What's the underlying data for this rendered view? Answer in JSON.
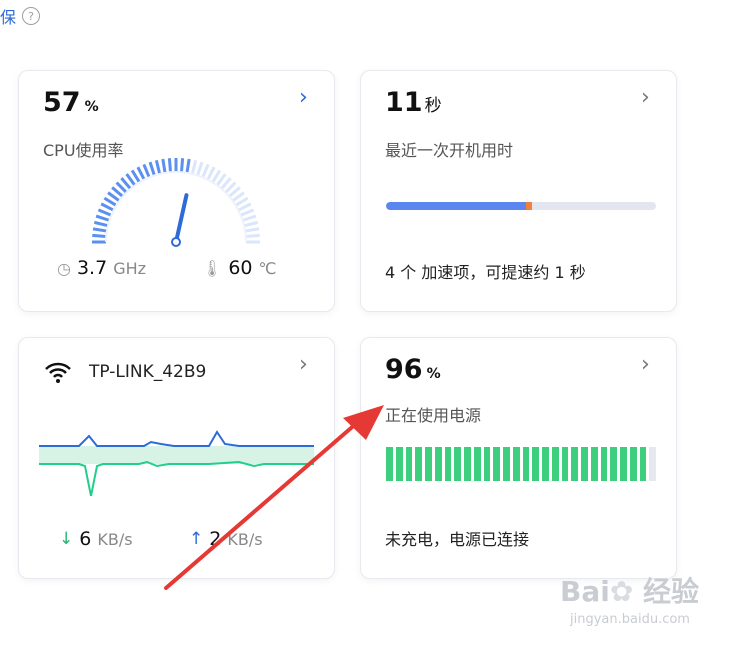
{
  "top": {
    "fragment": "保",
    "help": "?"
  },
  "cpu": {
    "value": "57",
    "unit": "%",
    "label": "CPU使用率",
    "freq_value": "3.7",
    "freq_unit": "GHz",
    "temp_value": "60",
    "temp_unit": "℃",
    "usage_fraction": 0.57,
    "chevron": "›",
    "clock_icon": "clock-icon",
    "thermo_icon": "thermometer-icon"
  },
  "boot": {
    "value": "11",
    "unit": "秒",
    "label": "最近一次开机用时",
    "progress_fraction": 0.52,
    "tip": "4 个 加速项，可提速约 1 秒",
    "chevron": "›"
  },
  "network": {
    "ssid": "TP-LINK_42B9",
    "down_value": "6",
    "down_unit": "KB/s",
    "up_value": "2",
    "up_unit": "KB/s",
    "chevron": "›",
    "icons": [
      "wifi-icon",
      "arrow-down-icon",
      "arrow-up-icon"
    ]
  },
  "power": {
    "value": "96",
    "unit": "%",
    "label": "正在使用电源",
    "level_fraction": 0.96,
    "status": "未充电，电源已连接",
    "chevron": "›"
  },
  "watermark": {
    "brand": "Bai 经验",
    "url": "jingyan.baidu.com"
  },
  "colors": {
    "accent": "#2c6bd8",
    "bar": "#5b86f0",
    "battery": "#3ecf7e",
    "arrow": "#e53935",
    "down": "#22b573",
    "up": "#2c6bd8"
  }
}
